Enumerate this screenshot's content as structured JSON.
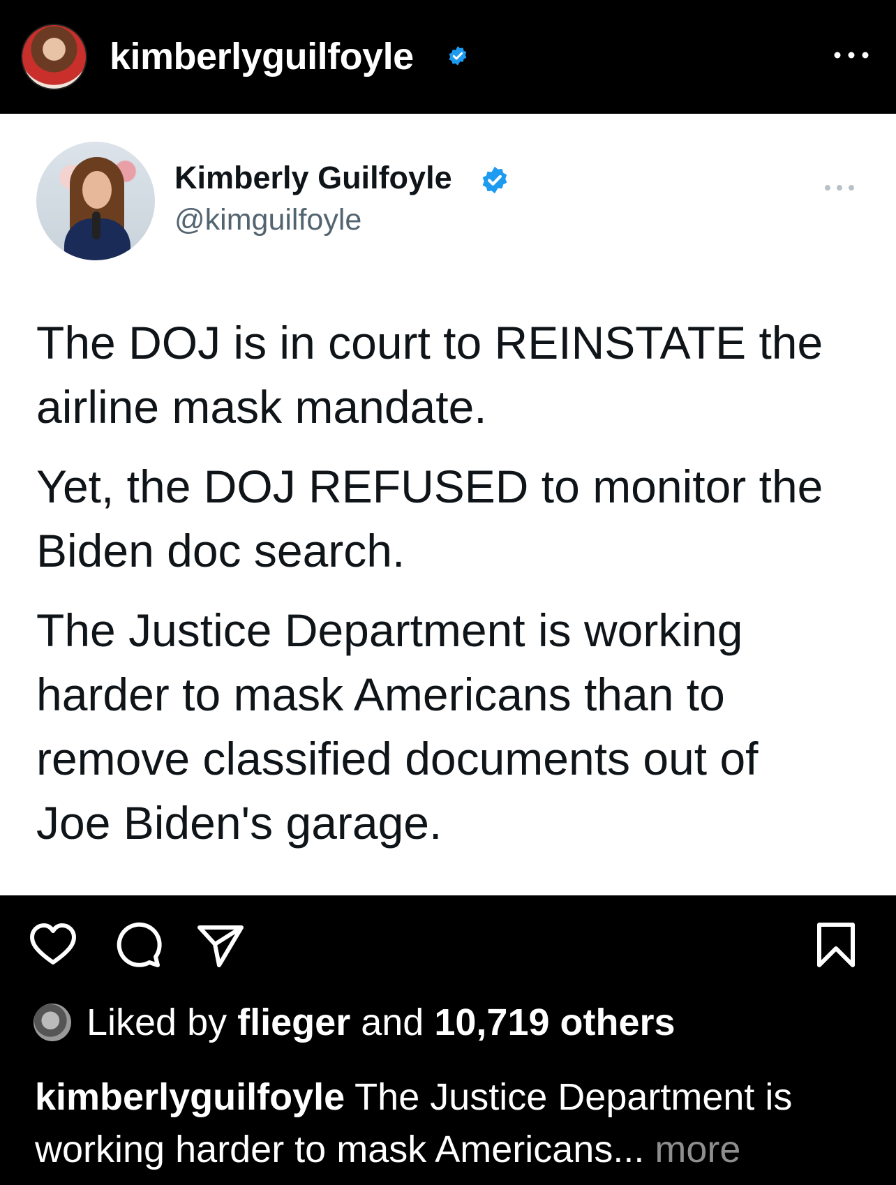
{
  "post_header": {
    "username": "kimberlyguilfoyle"
  },
  "tweet": {
    "display_name": "Kimberly Guilfoyle",
    "handle": "@kimguilfoyle",
    "paragraphs": [
      "The DOJ is in court to REINSTATE the\nairline mask mandate.",
      "Yet, the DOJ REFUSED to monitor the\nBiden doc search.",
      "The Justice Department is working\nharder to mask Americans than to\nremove classified documents out of\nJoe Biden's garage."
    ]
  },
  "likes": {
    "prefix": "Liked by",
    "first_liker": "flieger",
    "conjunction": "and",
    "others": "10,719 others"
  },
  "caption": {
    "username": "kimberlyguilfoyle",
    "text": "The Justice Department is working harder to mask Americans...",
    "more": "more"
  },
  "icons": {
    "verified_color": "#1d9bf0",
    "items": [
      "heart-icon",
      "comment-icon",
      "share-icon",
      "bookmark-icon",
      "more-icon",
      "verified-icon"
    ]
  }
}
